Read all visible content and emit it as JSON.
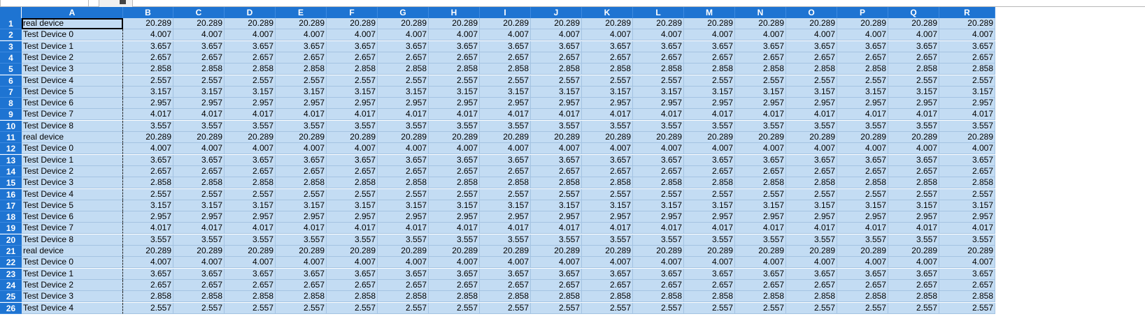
{
  "sheet": {
    "columns": [
      "A",
      "B",
      "C",
      "D",
      "E",
      "F",
      "G",
      "H",
      "I",
      "J",
      "K",
      "L",
      "M",
      "N",
      "O",
      "P",
      "Q",
      "R"
    ],
    "rows": [
      {
        "num": "1",
        "label": "real device",
        "value": "20.289"
      },
      {
        "num": "2",
        "label": "Test Device 0",
        "value": "4.007"
      },
      {
        "num": "3",
        "label": "Test Device 1",
        "value": "3.657"
      },
      {
        "num": "4",
        "label": "Test Device 2",
        "value": "2.657"
      },
      {
        "num": "5",
        "label": "Test Device 3",
        "value": "2.858"
      },
      {
        "num": "6",
        "label": "Test Device 4",
        "value": "2.557"
      },
      {
        "num": "7",
        "label": "Test Device 5",
        "value": "3.157"
      },
      {
        "num": "8",
        "label": "Test Device 6",
        "value": "2.957"
      },
      {
        "num": "9",
        "label": "Test Device 7",
        "value": "4.017"
      },
      {
        "num": "10",
        "label": "Test Device 8",
        "value": "3.557"
      },
      {
        "num": "11",
        "label": "real device",
        "value": "20.289"
      },
      {
        "num": "12",
        "label": "Test Device 0",
        "value": "4.007"
      },
      {
        "num": "13",
        "label": "Test Device 1",
        "value": "3.657"
      },
      {
        "num": "14",
        "label": "Test Device 2",
        "value": "2.657"
      },
      {
        "num": "15",
        "label": "Test Device 3",
        "value": "2.858"
      },
      {
        "num": "16",
        "label": "Test Device 4",
        "value": "2.557"
      },
      {
        "num": "17",
        "label": "Test Device 5",
        "value": "3.157"
      },
      {
        "num": "18",
        "label": "Test Device 6",
        "value": "2.957"
      },
      {
        "num": "19",
        "label": "Test Device 7",
        "value": "4.017"
      },
      {
        "num": "20",
        "label": "Test Device 8",
        "value": "3.557"
      },
      {
        "num": "21",
        "label": "real device",
        "value": "20.289"
      },
      {
        "num": "22",
        "label": "Test Device 0",
        "value": "4.007"
      },
      {
        "num": "23",
        "label": "Test Device 1",
        "value": "3.657"
      },
      {
        "num": "24",
        "label": "Test Device 2",
        "value": "2.657"
      },
      {
        "num": "25",
        "label": "Test Device 3",
        "value": "2.858"
      },
      {
        "num": "26",
        "label": "Test Device 4",
        "value": "2.557"
      }
    ]
  },
  "colors": {
    "header_bg": "#1e74d2",
    "cell_bg": "#c3dcf3",
    "grid_line": "#a4c3e2"
  }
}
